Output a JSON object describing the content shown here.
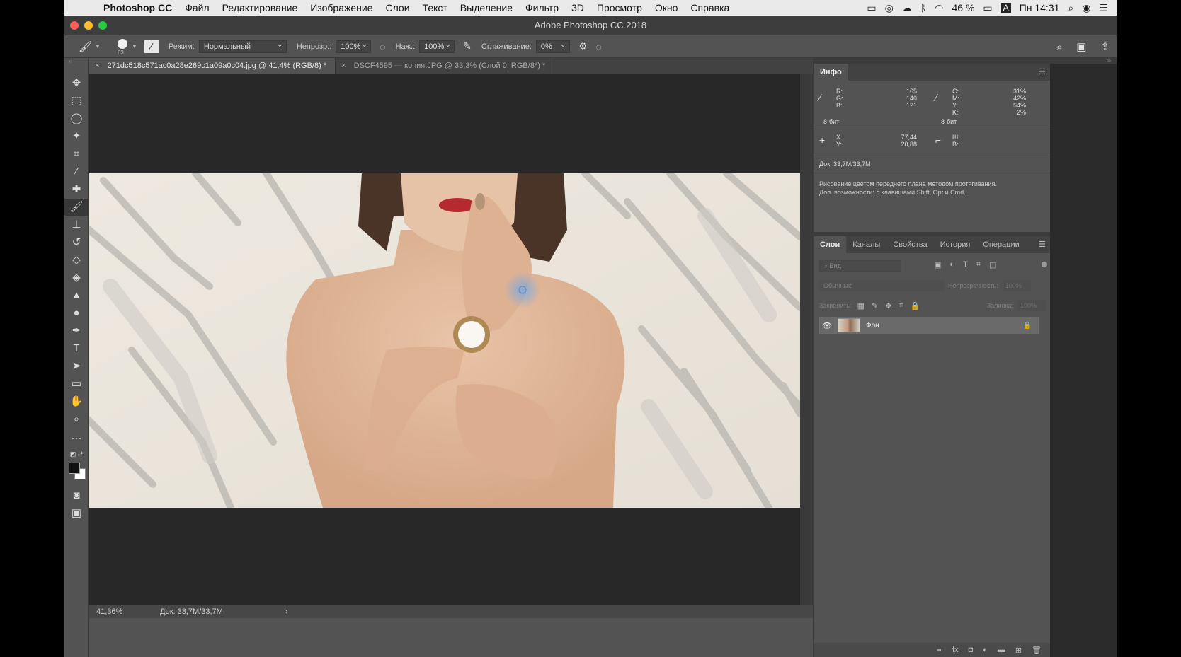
{
  "menubar": {
    "apple_icon": "apple-logo-icon",
    "app_name": "Photoshop CC",
    "items": [
      "Файл",
      "Редактирование",
      "Изображение",
      "Слои",
      "Текст",
      "Выделение",
      "Фильтр",
      "3D",
      "Просмотр",
      "Окно",
      "Справка"
    ],
    "battery": "46 %",
    "input_source": "A",
    "clock": "Пн 14:31"
  },
  "window": {
    "title": "Adobe Photoshop CC 2018"
  },
  "options_bar": {
    "brush_size": "63",
    "mode_label": "Режим:",
    "mode_value": "Нормальный",
    "opacity_label": "Непрозр.:",
    "opacity_value": "100%",
    "flow_label": "Наж.:",
    "flow_value": "100%",
    "smoothing_label": "Сглаживание:",
    "smoothing_value": "0%"
  },
  "documents": {
    "tabs": [
      {
        "label": "271dc518c571ac0a28e269c1a09a0c04.jpg @ 41,4% (RGB/8) *",
        "active": true
      },
      {
        "label": "DSCF4595 — копия.JPG @ 33,3% (Слой 0, RGB/8*) *",
        "active": false
      }
    ]
  },
  "status_bar": {
    "zoom": "41,36%",
    "doc_size": "Док: 33,7M/33,7M",
    "arrow": "›"
  },
  "info_panel": {
    "tab_label": "Инфо",
    "rgb": {
      "r_label": "R:",
      "g_label": "G:",
      "b_label": "B:",
      "r": "165",
      "g": "140",
      "b": "121",
      "bits": "8-бит"
    },
    "cmyk": {
      "c_label": "C:",
      "m_label": "M:",
      "y_label": "Y:",
      "k_label": "K:",
      "c": "31%",
      "m": "42%",
      "y": "54%",
      "k": "2%",
      "bits": "8-бит"
    },
    "coords": {
      "x_label": "X:",
      "y_label": "Y:",
      "x": "77,44",
      "y": "20,88"
    },
    "size": {
      "w_label": "Ш:",
      "h_label": "В:"
    },
    "doc_size": "Док: 33,7M/33,7M",
    "hint_line1": "Рисование цветом переднего плана методом протягивания.",
    "hint_line2": "Доп. возможности: с клавишами Shift, Opt и Cmd."
  },
  "layers_panel": {
    "tabs": [
      "Слои",
      "Каналы",
      "Свойства",
      "История",
      "Операции"
    ],
    "search_placeholder": "Вид",
    "blend_mode": "Обычные",
    "opacity_label": "Непрозрачность:",
    "opacity_value": "100%",
    "lock_label": "Закрепить:",
    "fill_label": "Заливка:",
    "fill_value": "100%",
    "layers": [
      {
        "name": "Фон",
        "visible": true,
        "locked": true
      }
    ]
  },
  "colors": {
    "accent": "#535353",
    "foreground": "#111111",
    "background": "#ffffff",
    "brush_cursor": "#6fa8e8"
  }
}
